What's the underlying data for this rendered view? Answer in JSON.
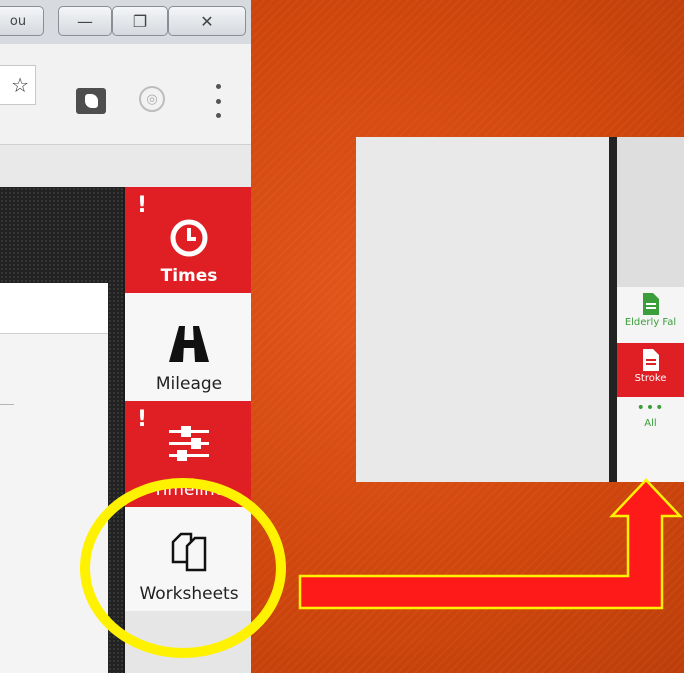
{
  "window": {
    "controls": [
      "ou",
      "—",
      "❐",
      "✕"
    ]
  },
  "toolbar": {
    "star_icon": "☆"
  },
  "rail": {
    "tiles": [
      {
        "label": "Times",
        "style": "red",
        "alert": "!"
      },
      {
        "label": "Mileage",
        "style": "white"
      },
      {
        "label": "Timeline",
        "style": "red",
        "alert": "!"
      },
      {
        "label": "Worksheets",
        "style": "white"
      }
    ]
  },
  "zoom": {
    "items": [
      {
        "label": "Elderly Fal",
        "style": "white",
        "color": "#3a9e3a"
      },
      {
        "label": "Stroke",
        "style": "red",
        "color": "#ffffff"
      },
      {
        "label": "All",
        "style": "white",
        "color": "#3a9e3a"
      }
    ]
  },
  "colors": {
    "accent_red": "#e01f25",
    "highlight_yellow": "#fff200",
    "arrow_red": "#ff1a1a",
    "background": "#d44a0c"
  }
}
